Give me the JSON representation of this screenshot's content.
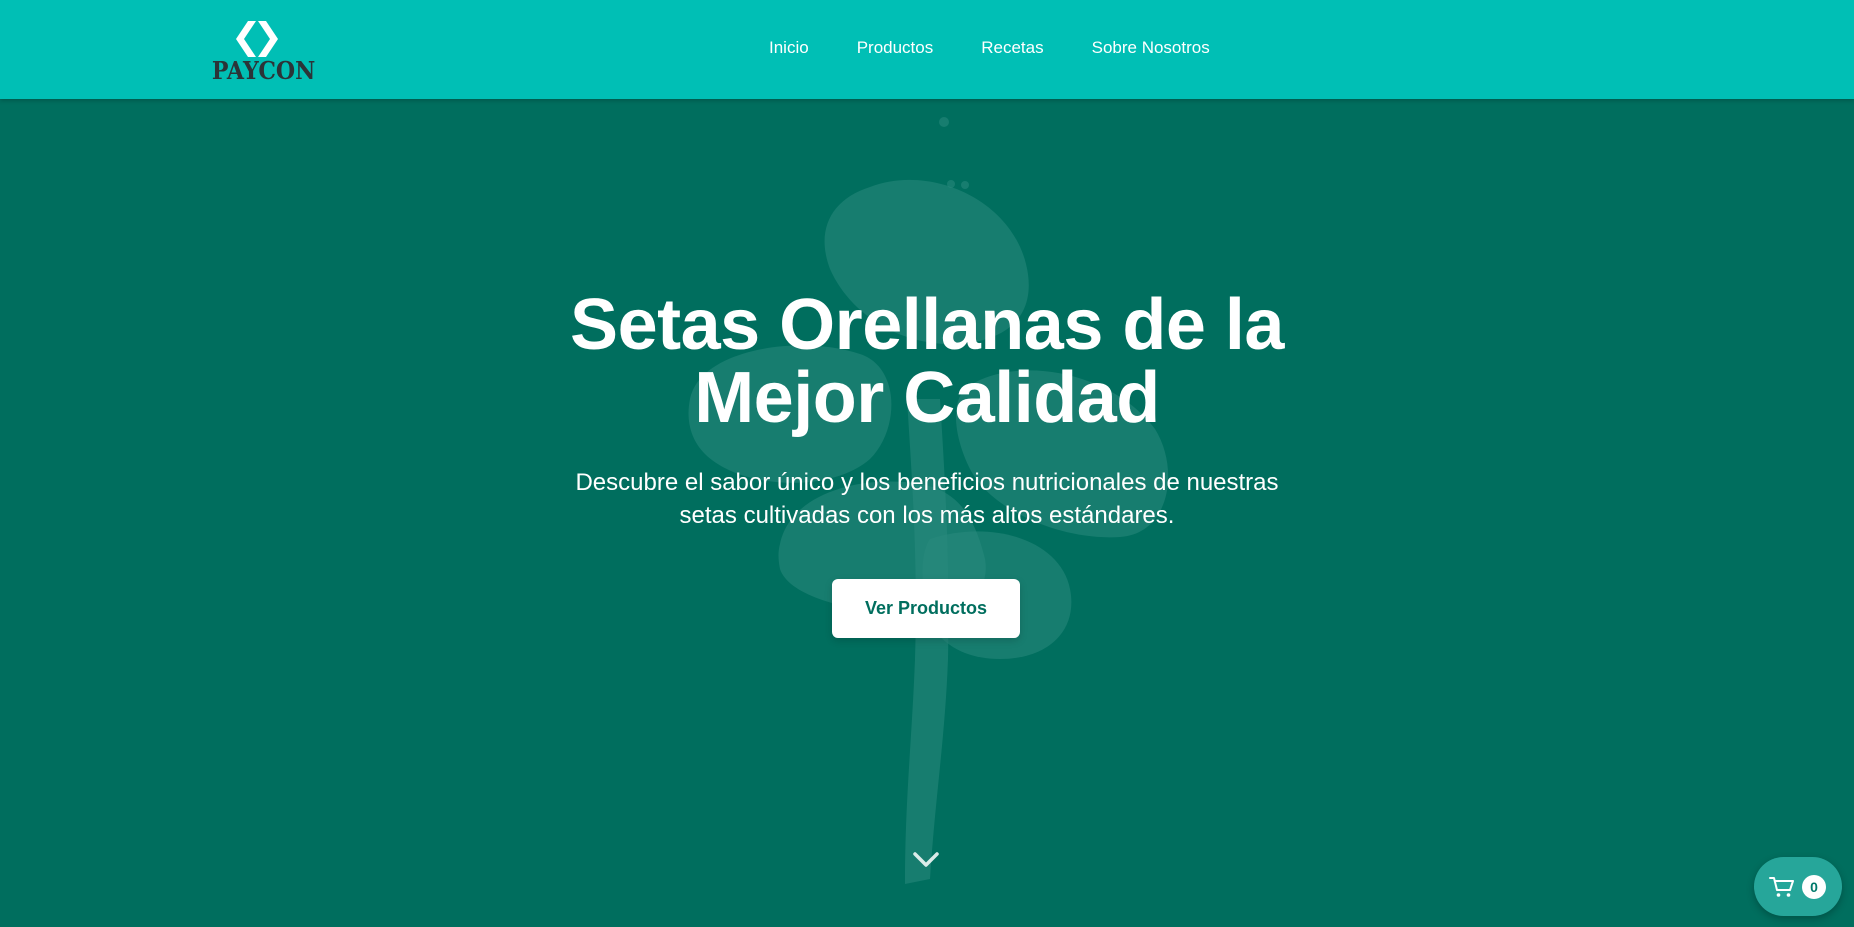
{
  "brand": {
    "name": "PAYCON"
  },
  "nav": {
    "items": [
      {
        "label": "Inicio"
      },
      {
        "label": "Productos"
      },
      {
        "label": "Recetas"
      },
      {
        "label": "Sobre Nosotros"
      }
    ]
  },
  "hero": {
    "title_line1": "Setas Orellanas de la",
    "title_line2": "Mejor Calidad",
    "subtitle_line1": "Descubre el sabor único y los beneficios nutricionales de nuestras",
    "subtitle_line2": "setas cultivadas con los más altos estándares.",
    "cta_label": "Ver Productos"
  },
  "cart": {
    "count": "0",
    "icon": "cart-icon"
  },
  "icons": {
    "scroll": "chevron-down-icon",
    "logo": "logo-mark-icon"
  },
  "colors": {
    "navbar": "#00bfb5",
    "hero_bg": "#006e5e",
    "cta_text": "#006e5e",
    "cart_fab": "#26a69a",
    "logo_text": "#2b3438"
  }
}
